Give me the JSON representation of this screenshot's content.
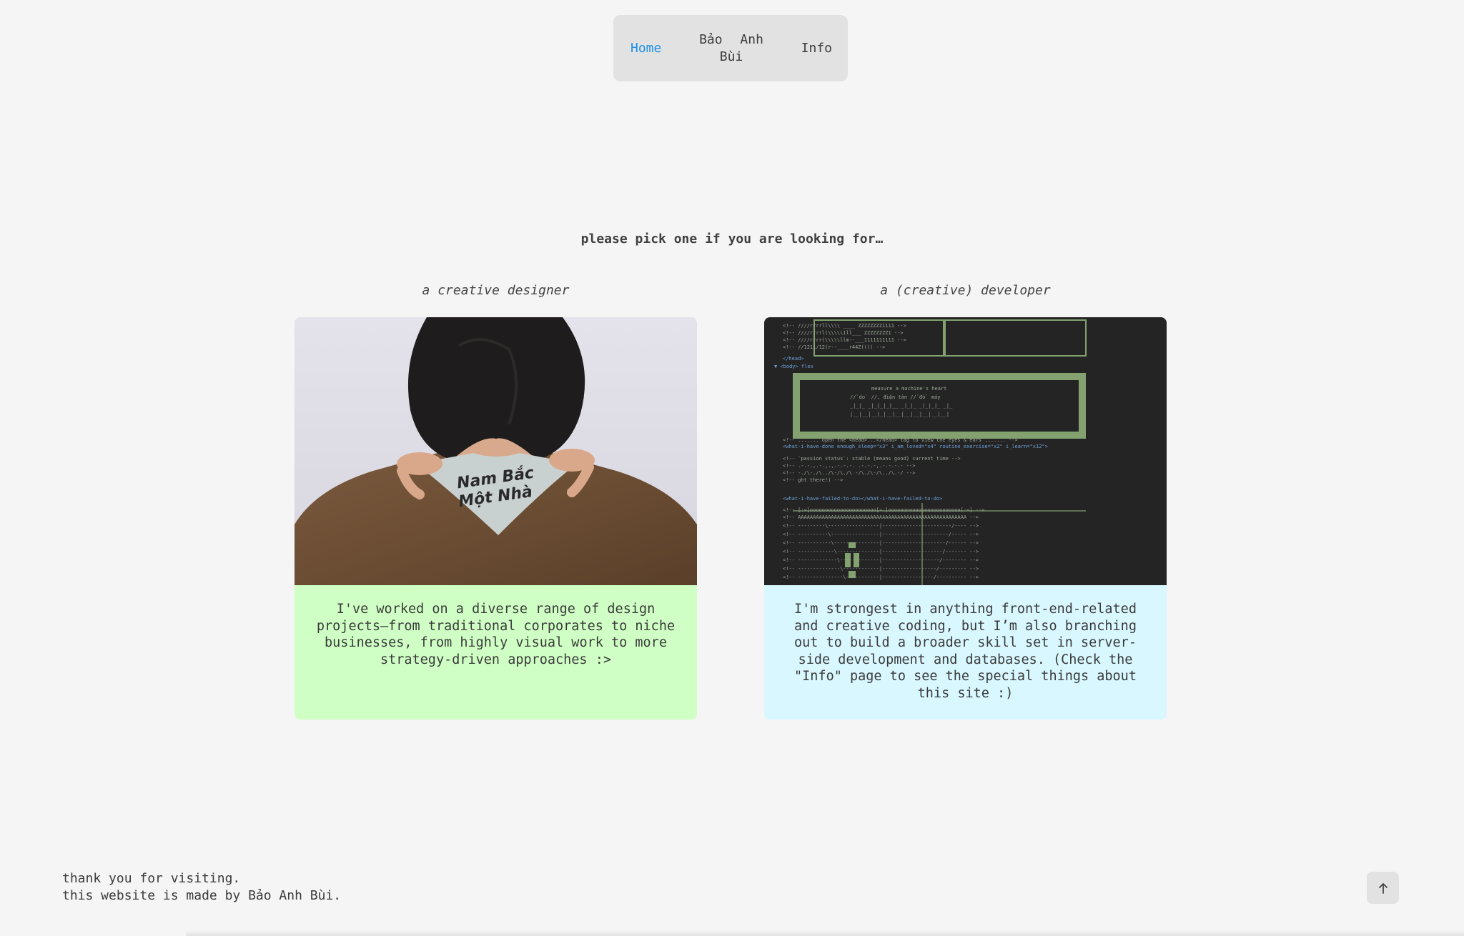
{
  "nav": {
    "items": [
      {
        "label": "Home",
        "active": true
      },
      {
        "label": "Bảo Anh Bùi",
        "active": false
      },
      {
        "label": "Info",
        "active": false
      }
    ]
  },
  "main": {
    "heading": "please pick one if you are looking for…",
    "cards": [
      {
        "title": "a creative designer",
        "image_alt": "person from behind wearing a collar printed Nam Bắc Một Nhà",
        "collar_text": "Nam Bắc Một Nhà",
        "description": "I've worked on a diverse range of design projects—from traditional corporates to niche businesses, from highly visual work to more strategy-driven approaches :>",
        "bg_color": "#cfffc4"
      },
      {
        "title": "a (creative) developer",
        "image_alt": "browser devtools showing ASCII-art HTML comments",
        "description": "I'm strongest in anything front-end-related and creative coding, but I’m also branching out to build a broader skill set in server-side development and databases. (Check the \"Info\" page to see the special things about this site :)",
        "bg_color": "#d8f7ff"
      }
    ]
  },
  "footer": {
    "line1": "thank you for visiting.",
    "line2": "this website is made by Bảo Anh Bùi."
  },
  "scroll_top": {
    "icon": "arrow-up-icon"
  },
  "colors": {
    "accent": "#1e90e6",
    "page_bg": "#f5f5f5",
    "nav_bg": "#e2e2e2"
  }
}
